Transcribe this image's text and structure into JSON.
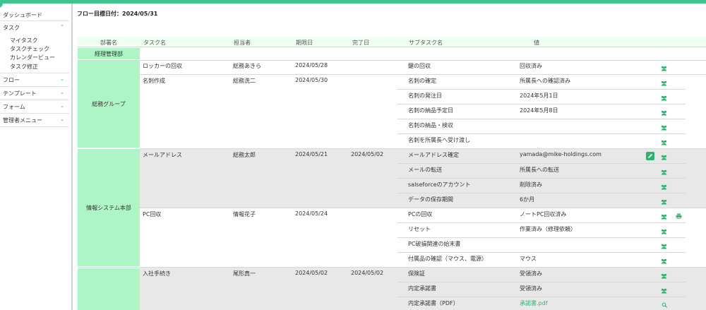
{
  "sidebar": {
    "dashboard": "ダッシュボード",
    "task": "タスク",
    "task_sub": [
      "マイタスク",
      "タスクチェック",
      "カレンダービュー",
      "タスク修正"
    ],
    "flow": "フロー",
    "template": "テンプレート",
    "form": "フォーム",
    "admin": "管理者メニュー"
  },
  "header": {
    "flow_date": "フロー目標日付：2024/05/31"
  },
  "columns": [
    "部署名",
    "タスク名",
    "担当者",
    "期限日",
    "完了日",
    "サブタスク名",
    "値"
  ],
  "depts": {
    "keiri": "経理管理部",
    "somu": "総務グループ",
    "joho": "情報システム本部"
  },
  "tasks": [
    {
      "name": "ロッカーの回収",
      "person": "総務あきら",
      "due": "2024/05/28",
      "done": ""
    },
    {
      "name": "名刺作成",
      "person": "総務洗二",
      "due": "2024/05/30",
      "done": ""
    },
    {
      "name": "メールアドレス",
      "person": "総務太郎",
      "due": "2024/05/21",
      "done": "2024/05/02"
    },
    {
      "name": "PC回収",
      "person": "情報花子",
      "due": "2024/05/24",
      "done": ""
    },
    {
      "name": "入社手続き",
      "person": "尾形真一",
      "due": "2024/05/02",
      "done": "2024/05/02"
    }
  ],
  "subtasks": [
    {
      "name": "鍵の回収",
      "value": "回収済み"
    },
    {
      "name": "名刺の確定",
      "value": "所属長への確認済み"
    },
    {
      "name": "名刺の発注日",
      "value": "2024年5月1日"
    },
    {
      "name": "名刺の納品予定日",
      "value": "2024年5月8日"
    },
    {
      "name": "名刺の納品・検収",
      "value": ""
    },
    {
      "name": "名刺を所属長へ受け渡し",
      "value": ""
    },
    {
      "name": "メールアドレス確定",
      "value": "yamada@mike-holdings.com"
    },
    {
      "name": "メールの転送",
      "value": "所属長への転送"
    },
    {
      "name": "salseforceのアカウント",
      "value": "削除済み"
    },
    {
      "name": "データの保存期間",
      "value": "6か月"
    },
    {
      "name": "PCの回収",
      "value": "ノートPC回収済み"
    },
    {
      "name": "リセット",
      "value": "作業済み（修理依頼）"
    },
    {
      "name": "PC破損関連の始末書",
      "value": ""
    },
    {
      "name": "付属品の確認（マウス、電源）",
      "value": "マウス"
    },
    {
      "name": "保険証",
      "value": "受領済み"
    },
    {
      "name": "内定承諾書",
      "value": "受領済み"
    },
    {
      "name": "内定承諾書（PDF）",
      "value": "承諾書.pdf"
    }
  ],
  "colors": {
    "accent": "#3ec58c",
    "dept_bg": "#aef5c6",
    "header_bg": "#effff0",
    "grey_bg": "#e8e8e8"
  },
  "icons": {
    "people": "people-icon",
    "edit": "pencil-icon",
    "print": "printer-icon",
    "search": "magnifier-icon"
  }
}
